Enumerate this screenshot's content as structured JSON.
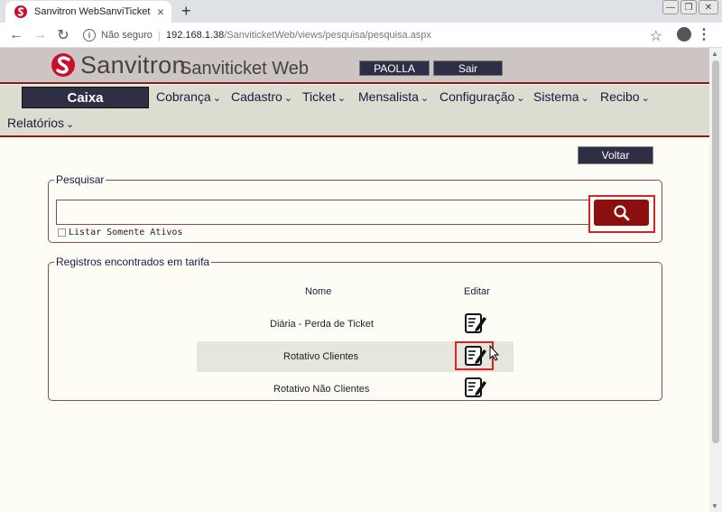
{
  "browser": {
    "tab_title": "Sanvitron WebSanviTicket",
    "tab_close": "×",
    "new_tab": "+",
    "security": "Não seguro",
    "url_host": "192.168.1.38",
    "url_path": "/SanviticketWeb/views/pesquisa/pesquisa.aspx"
  },
  "header": {
    "brand": "Sanvitron",
    "product": "Sanviticket Web",
    "user": "PAOLLA",
    "logout": "Sair"
  },
  "menu": {
    "active": "Caixa",
    "items": [
      "Cobrança",
      "Cadastro",
      "Ticket",
      "Mensalista",
      "Configuração",
      "Sistema",
      "Recibo",
      "Relatórios"
    ]
  },
  "page": {
    "back": "Voltar",
    "search_legend": "Pesquisar",
    "search_value": "",
    "only_active": "Listar Somente Ativos",
    "results_legend": "Registros encontrados em tarifa",
    "col_name": "Nome",
    "col_edit": "Editar",
    "rows": [
      {
        "name": "Diária - Perda de Ticket"
      },
      {
        "name": "Rotativo Clientes"
      },
      {
        "name": "Rotativo Não Clientes"
      }
    ]
  },
  "colors": {
    "accent": "#8b1a1a",
    "nav_dark": "#2e2e45",
    "highlight": "#d9232a"
  }
}
